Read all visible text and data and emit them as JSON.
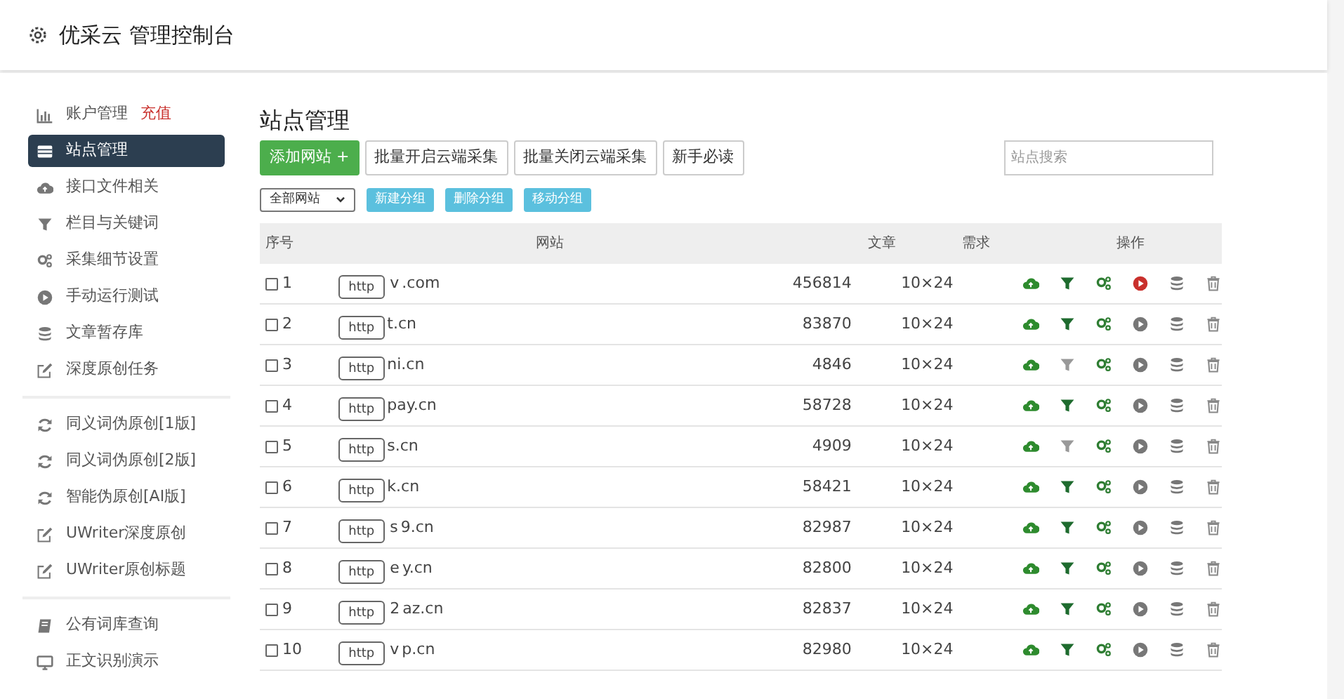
{
  "header": {
    "title": "优采云 管理控制台"
  },
  "sidebar": {
    "groups": [
      {
        "items": [
          {
            "kind": "chart",
            "label": "账户管理",
            "badge": "充值",
            "selected": false
          },
          {
            "kind": "list",
            "label": "站点管理",
            "selected": true
          },
          {
            "kind": "cloud",
            "label": "接口文件相关",
            "selected": false
          },
          {
            "kind": "filter",
            "label": "栏目与关键词",
            "selected": false
          },
          {
            "kind": "gears",
            "label": "采集细节设置",
            "selected": false
          },
          {
            "kind": "play",
            "label": "手动运行测试",
            "selected": false
          },
          {
            "kind": "database",
            "label": "文章暂存库",
            "selected": false
          },
          {
            "kind": "edit",
            "label": "深度原创任务",
            "selected": false
          }
        ]
      },
      {
        "items": [
          {
            "kind": "refresh",
            "label": "同义词伪原创[1版]",
            "selected": false
          },
          {
            "kind": "refresh",
            "label": "同义词伪原创[2版]",
            "selected": false
          },
          {
            "kind": "refresh",
            "label": "智能伪原创[AI版]",
            "selected": false
          },
          {
            "kind": "edit",
            "label": "UWriter深度原创",
            "selected": false
          },
          {
            "kind": "edit",
            "label": "UWriter原创标题",
            "selected": false
          }
        ]
      },
      {
        "items": [
          {
            "kind": "book",
            "label": "公有词库查询",
            "selected": false
          },
          {
            "kind": "monitor",
            "label": "正文识别演示",
            "selected": false
          }
        ]
      }
    ]
  },
  "main": {
    "title": "站点管理",
    "toolbar": [
      {
        "kind": "primary",
        "label": "添加网站 +"
      },
      {
        "kind": "default",
        "label": "批量开启云端采集"
      },
      {
        "kind": "default",
        "label": "批量关闭云端采集"
      },
      {
        "kind": "default",
        "label": "新手必读"
      }
    ],
    "search": {
      "placeholder": "站点搜索"
    },
    "group_select": {
      "value": "全部网站"
    },
    "group_buttons": [
      "新建分组",
      "删除分组",
      "移动分组"
    ],
    "table": {
      "columns": [
        "序号",
        "网站",
        "文章",
        "需求",
        "操作"
      ],
      "rows": [
        {
          "checked": false,
          "index": "1",
          "scheme": "http",
          "site_prefix": "v",
          "site_suffix": ".com",
          "articles": "456814",
          "demand": "10×24",
          "filter_on": true,
          "running": true
        },
        {
          "checked": false,
          "index": "2",
          "scheme": "http",
          "site_suffix": "t.cn",
          "articles": "83870",
          "demand": "10×24",
          "filter_on": true,
          "running": false
        },
        {
          "checked": false,
          "index": "3",
          "scheme": "http",
          "site_suffix": "ni.cn",
          "articles": "4846",
          "demand": "10×24",
          "filter_on": false,
          "running": false
        },
        {
          "checked": false,
          "index": "4",
          "scheme": "http",
          "site_suffix": "pay.cn",
          "articles": "58728",
          "demand": "10×24",
          "filter_on": true,
          "running": false
        },
        {
          "checked": false,
          "index": "5",
          "scheme": "http",
          "site_suffix": "s.cn",
          "articles": "4909",
          "demand": "10×24",
          "filter_on": false,
          "running": false
        },
        {
          "checked": false,
          "index": "6",
          "scheme": "http",
          "site_suffix": "k.cn",
          "articles": "58421",
          "demand": "10×24",
          "filter_on": true,
          "running": false
        },
        {
          "checked": false,
          "index": "7",
          "scheme": "http",
          "site_prefix": "s",
          "site_suffix": "9.cn",
          "articles": "82987",
          "demand": "10×24",
          "filter_on": true,
          "running": false
        },
        {
          "checked": false,
          "index": "8",
          "scheme": "http",
          "site_prefix": "e",
          "site_suffix": "y.cn",
          "articles": "82800",
          "demand": "10×24",
          "filter_on": true,
          "running": false
        },
        {
          "checked": false,
          "index": "9",
          "scheme": "http",
          "site_prefix": "2",
          "site_suffix": "az.cn",
          "articles": "82837",
          "demand": "10×24",
          "filter_on": true,
          "running": false
        },
        {
          "checked": false,
          "index": "10",
          "scheme": "http",
          "site_prefix": "v",
          "site_suffix": "p.cn",
          "articles": "82980",
          "demand": "10×24",
          "filter_on": true,
          "running": false
        }
      ]
    }
  }
}
